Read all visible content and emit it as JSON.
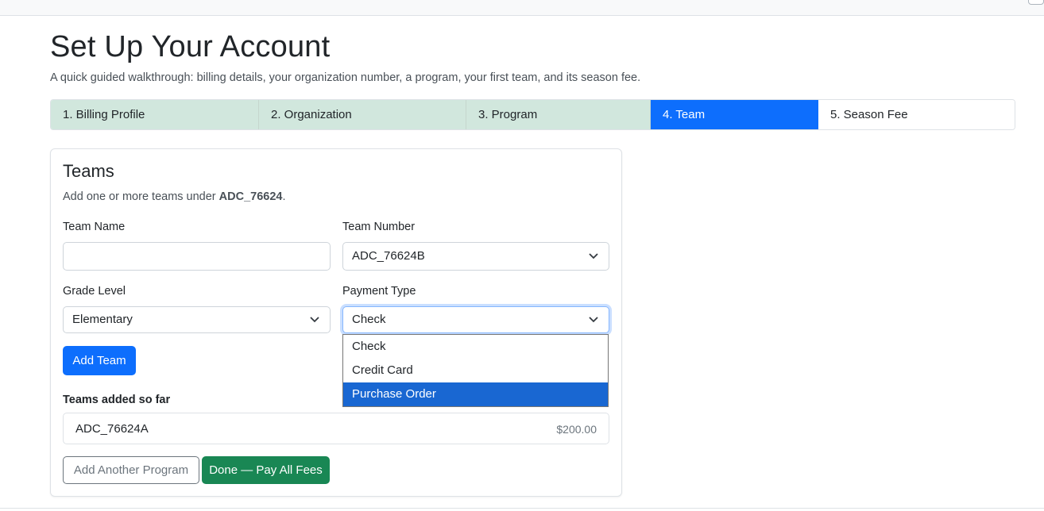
{
  "page": {
    "title": "Set Up Your Account",
    "subtitle": "A quick guided walkthrough: billing details, your organization number, a program, your first team, and its season fee."
  },
  "steps": [
    {
      "label": "1. Billing Profile",
      "state": "done"
    },
    {
      "label": "2. Organization",
      "state": "done"
    },
    {
      "label": "3. Program",
      "state": "done"
    },
    {
      "label": "4. Team",
      "state": "active"
    },
    {
      "label": "5. Season Fee",
      "state": "todo"
    }
  ],
  "card": {
    "title": "Teams",
    "subtitle_prefix": "Add one or more teams under ",
    "org_number": "ADC_76624",
    "subtitle_suffix": "."
  },
  "form": {
    "team_name": {
      "label": "Team Name",
      "value": ""
    },
    "team_number": {
      "label": "Team Number",
      "value": "ADC_76624B"
    },
    "grade_level": {
      "label": "Grade Level",
      "value": "Elementary"
    },
    "payment_type": {
      "label": "Payment Type",
      "value": "Check",
      "options": [
        "Check",
        "Credit Card",
        "Purchase Order"
      ],
      "highlighted": "Purchase Order"
    }
  },
  "buttons": {
    "add_team": "Add Team",
    "add_program": "Add Another Program",
    "done": "Done — Pay All Fees"
  },
  "teams_list": {
    "heading": "Teams added so far",
    "items": [
      {
        "name": "ADC_76624A",
        "amount": "$200.00"
      }
    ]
  },
  "colors": {
    "primary": "#0d6efd",
    "success": "#198754",
    "step_done_bg": "#d1e7dd",
    "option_highlight": "#1967d2"
  }
}
